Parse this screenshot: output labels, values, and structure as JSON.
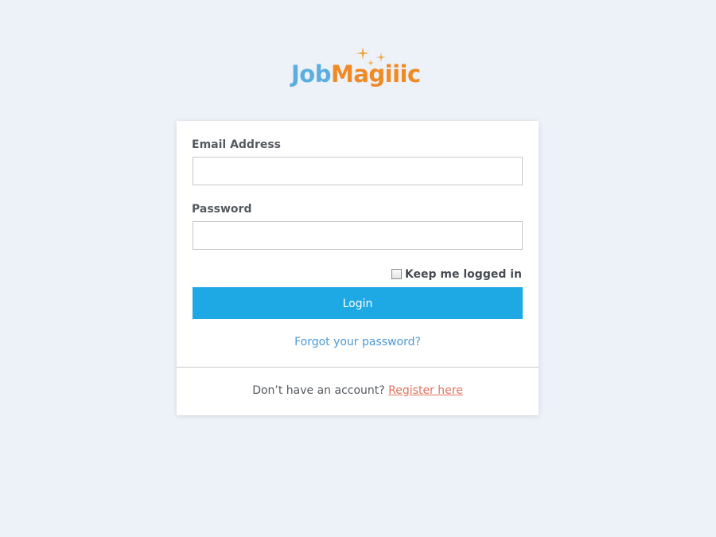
{
  "brand": {
    "logo_part1": "Job",
    "logo_part2": "Magiiic",
    "color_blue": "#5aaee0",
    "color_orange": "#f08a24",
    "sparkle_icon": "sparkle-icon"
  },
  "form": {
    "email_label": "Email Address",
    "email_value": "",
    "password_label": "Password",
    "password_value": "",
    "remember_label": "Keep me logged in",
    "remember_checked": false,
    "login_label": "Login",
    "forgot_label": "Forgot your password?"
  },
  "footer": {
    "prompt": "Don’t have an account?",
    "register_label": "Register here"
  },
  "colors": {
    "background": "#edf1f8",
    "button": "#1ea9e4",
    "link": "#4a9ad8",
    "register_link": "#e3715a"
  }
}
